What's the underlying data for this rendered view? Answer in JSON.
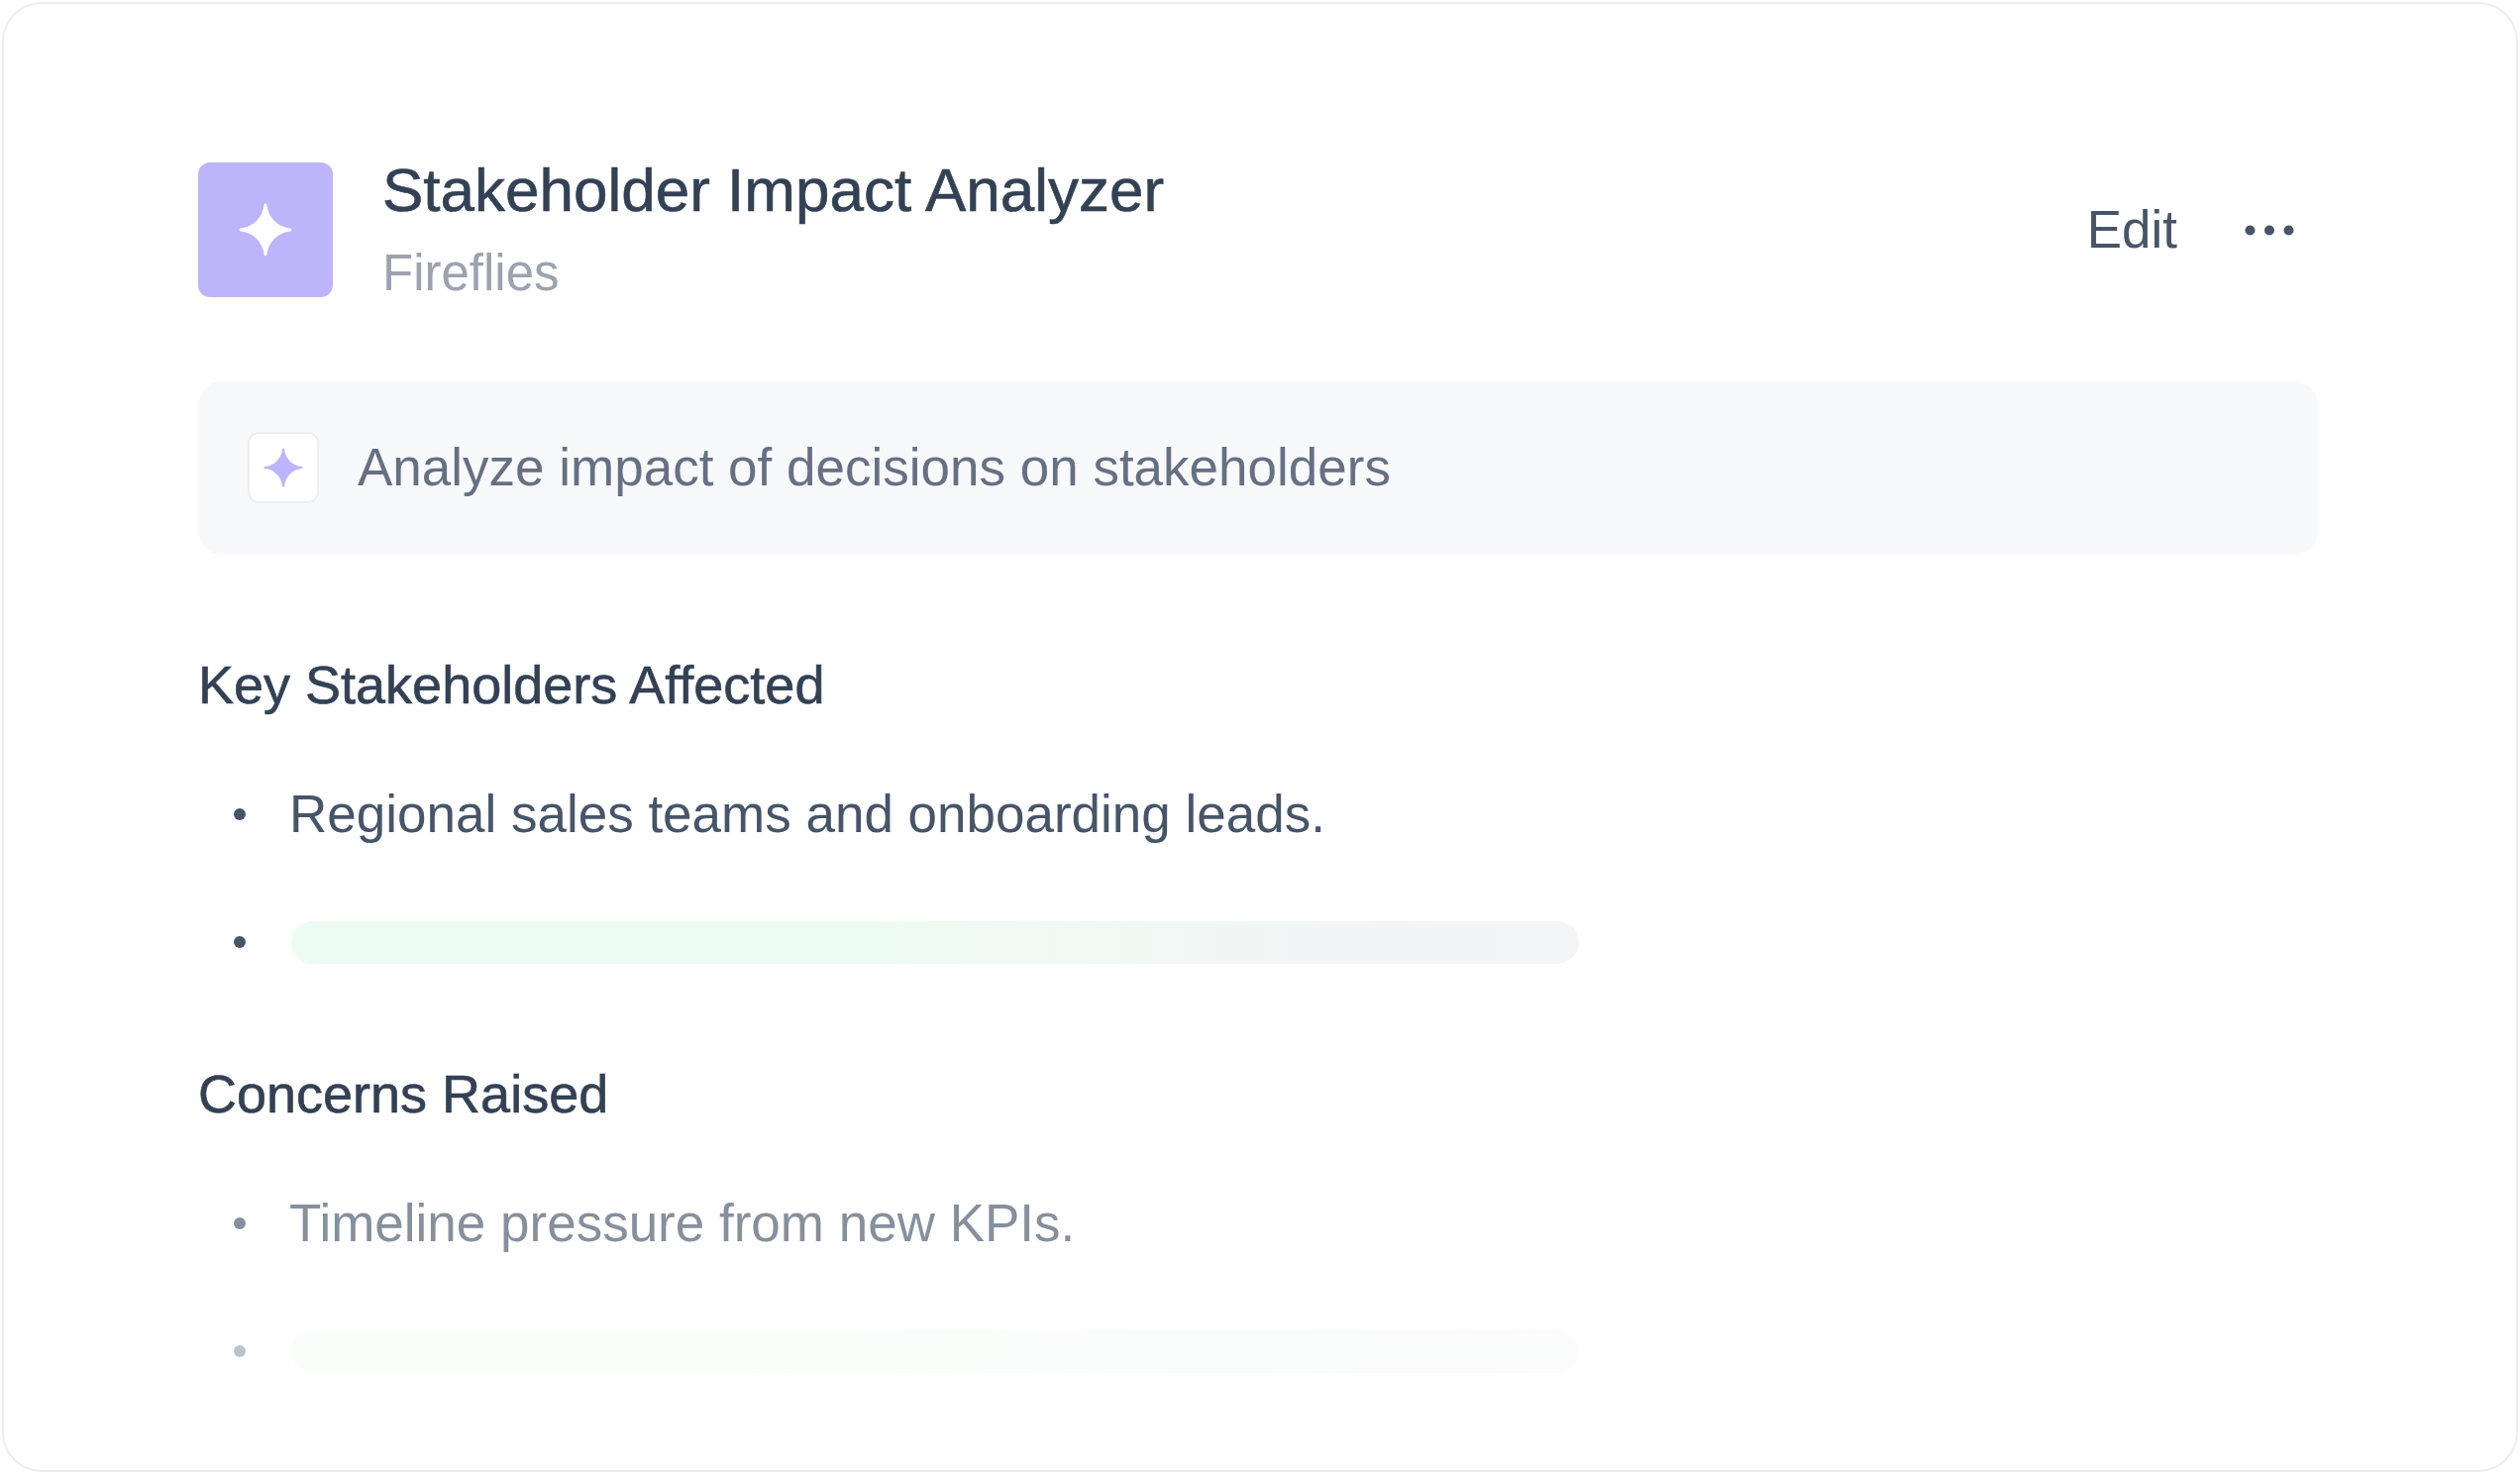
{
  "header": {
    "title": "Stakeholder Impact Analyzer",
    "source": "Fireflies",
    "edit_label": "Edit"
  },
  "prompt": {
    "text": "Analyze impact of decisions on stakeholders"
  },
  "sections": [
    {
      "heading": "Key Stakeholders Affected",
      "faded": false,
      "items": [
        {
          "kind": "text",
          "text": "Regional sales teams and onboarding leads."
        },
        {
          "kind": "skeleton"
        }
      ]
    },
    {
      "heading": "Concerns Raised",
      "faded": true,
      "items": [
        {
          "kind": "text",
          "text": "Timeline pressure from new KPIs."
        },
        {
          "kind": "skeleton"
        }
      ]
    }
  ]
}
